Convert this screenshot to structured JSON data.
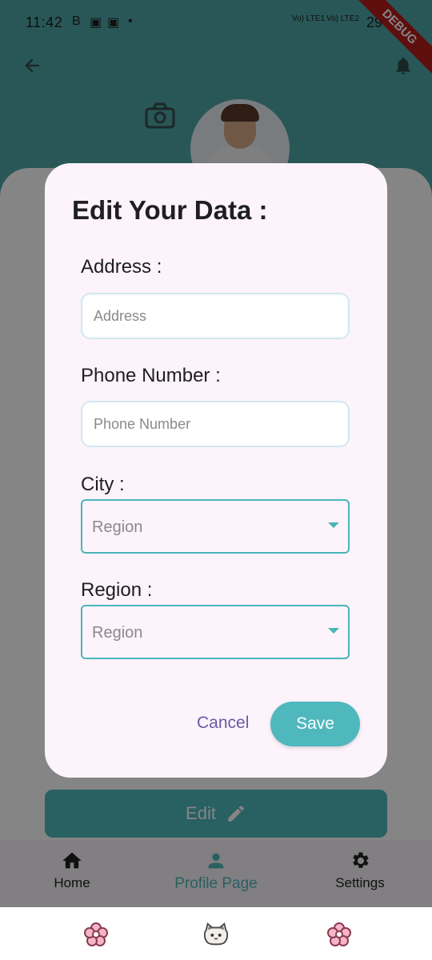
{
  "status_bar": {
    "time": "11:42",
    "indicators": [
      "B",
      "▣",
      "▣",
      "•"
    ],
    "network_1": "Vo) LTE1",
    "network_2": "Vo) LTE2",
    "battery": "29%",
    "debug_label": "DEBUG"
  },
  "header": {
    "back_icon": "arrow-left-icon",
    "bell_icon": "bell-icon",
    "avatar_icon": "camera-icon"
  },
  "main": {
    "edit_label": "Edit"
  },
  "dialog": {
    "title": "Edit Your Data :",
    "fields": [
      {
        "label": "Address :",
        "placeholder": "Address"
      },
      {
        "label": "Phone Number :",
        "placeholder": "Phone Number"
      },
      {
        "label": "City :",
        "selected": "Region"
      },
      {
        "label": "Region :",
        "selected": "Region"
      }
    ],
    "actions": {
      "cancel_label": "Cancel",
      "save_label": "Save"
    }
  },
  "bottom_nav": {
    "items": [
      {
        "label": "Home",
        "icon": "home-icon"
      },
      {
        "label": "Profile Page",
        "icon": "person-icon",
        "active": true
      },
      {
        "label": "Settings",
        "icon": "gear-icon"
      }
    ]
  },
  "colors": {
    "brand_teal": "#4fb8bd",
    "header_teal": "#4fa8a8",
    "dialog_bg": "#fcf3fb",
    "cancel_purple": "#6a5aa5",
    "debug_red": "#b71c1c"
  }
}
